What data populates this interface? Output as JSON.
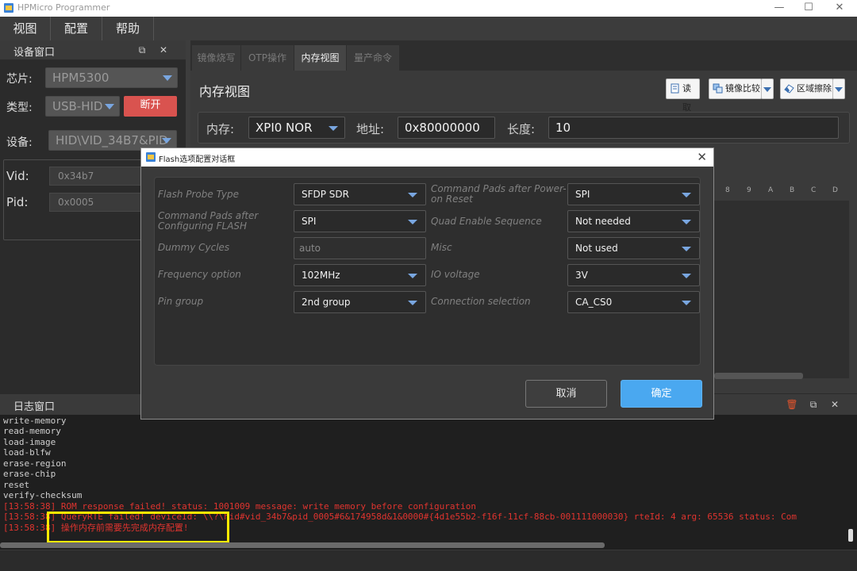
{
  "window": {
    "title": "HPMicro Programmer",
    "minimize_glyph": "—",
    "maximize_glyph": "☐",
    "close_glyph": "✕"
  },
  "menu": {
    "items": [
      {
        "label": "视图"
      },
      {
        "label": "配置"
      },
      {
        "label": "帮助"
      }
    ]
  },
  "device_panel": {
    "title": "设备窗口",
    "float_glyph": "⧉",
    "close_glyph": "✕",
    "chip_label": "芯片:",
    "chip_value": "HPM5300",
    "type_label": "类型:",
    "type_value": "USB-HID",
    "disconnect_label": "断开",
    "device_label": "设备:",
    "device_value": "HID\\VID_34B7&PID",
    "vid_label": "Vid:",
    "vid_value": "0x34b7",
    "pid_label": "Pid:",
    "pid_value": "0x0005"
  },
  "tabs": [
    {
      "label": "镜像烧写",
      "active": false
    },
    {
      "label": "OTP操作",
      "active": false
    },
    {
      "label": "内存视图",
      "active": true
    },
    {
      "label": "量产命令",
      "active": false
    }
  ],
  "memory_view": {
    "title": "内存视图",
    "read_label": "读取",
    "compare_label": "镜像比较",
    "erase_label": "区域擦除",
    "memory_label": "内存:",
    "memory_value": "XPI0 NOR",
    "address_label": "地址:",
    "address_value": "0x80000000",
    "length_label": "长度:",
    "length_value": "10",
    "hex_columns": [
      "8",
      "9",
      "A",
      "B",
      "C",
      "D"
    ]
  },
  "log": {
    "title": "日志窗口",
    "trash_glyph": "🗑",
    "float_glyph": "⧉",
    "close_glyph": "✕",
    "lines": [
      {
        "text": "write-memory",
        "error": false
      },
      {
        "text": "read-memory",
        "error": false
      },
      {
        "text": "load-image",
        "error": false
      },
      {
        "text": "load-blfw",
        "error": false
      },
      {
        "text": "erase-region",
        "error": false
      },
      {
        "text": "erase-chip",
        "error": false
      },
      {
        "text": "reset",
        "error": false
      },
      {
        "text": "verify-checksum",
        "error": false
      },
      {
        "text": "[13:58:38] ROM response failed! status: 1001009 message: write memory before configuration",
        "error": true
      },
      {
        "text": "[13:58:38] QueryRTE failed! deviceId: \\\\?\\hid#vid_34b7&pid_0005#6&174958d&1&0000#{4d1e55b2-f16f-11cf-88cb-001111000030} rteId: 4 arg: 65536 status: Com",
        "error": true
      },
      {
        "text": "[13:58:38] 操作内存前需要先完成内存配置!",
        "error": true
      }
    ]
  },
  "dialog": {
    "title": "Flash选项配置对话框",
    "close_glyph": "✕",
    "rows": [
      {
        "left_label": "Flash Probe Type",
        "left_value": "SFDP SDR",
        "right_label": "Command Pads after Power-on Reset",
        "right_value": "SPI"
      },
      {
        "left_label": "Command Pads after Configuring FLASH",
        "left_value": "SPI",
        "right_label": "Quad Enable Sequence",
        "right_value": "Not needed"
      },
      {
        "left_label": "Dummy Cycles",
        "left_value": "auto",
        "right_label": "Misc",
        "right_value": "Not used"
      },
      {
        "left_label": "Frequency option",
        "left_value": "102MHz",
        "right_label": "IO voltage",
        "right_value": "3V"
      },
      {
        "left_label": "Pin group",
        "left_value": "2nd group",
        "right_label": "Connection selection",
        "right_value": "CA_CS0"
      }
    ],
    "cancel_label": "取消",
    "ok_label": "确定"
  }
}
